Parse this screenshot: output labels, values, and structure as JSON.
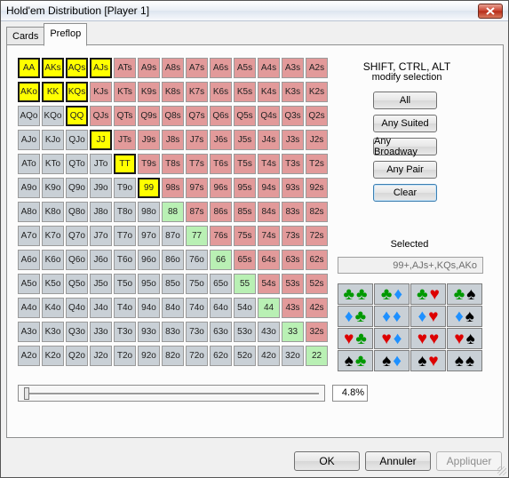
{
  "window": {
    "title": "Hold'em Distribution [Player 1]"
  },
  "tabs": [
    {
      "label": "Cards"
    },
    {
      "label": "Preflop"
    }
  ],
  "grid": {
    "rows": [
      [
        "AA",
        "AKs",
        "AQs",
        "AJs",
        "ATs",
        "A9s",
        "A8s",
        "A7s",
        "A6s",
        "A5s",
        "A4s",
        "A3s",
        "A2s"
      ],
      [
        "AKo",
        "KK",
        "KQs",
        "KJs",
        "KTs",
        "K9s",
        "K8s",
        "K7s",
        "K6s",
        "K5s",
        "K4s",
        "K3s",
        "K2s"
      ],
      [
        "AQo",
        "KQo",
        "QQ",
        "QJs",
        "QTs",
        "Q9s",
        "Q8s",
        "Q7s",
        "Q6s",
        "Q5s",
        "Q4s",
        "Q3s",
        "Q2s"
      ],
      [
        "AJo",
        "KJo",
        "QJo",
        "JJ",
        "JTs",
        "J9s",
        "J8s",
        "J7s",
        "J6s",
        "J5s",
        "J4s",
        "J3s",
        "J2s"
      ],
      [
        "ATo",
        "KTo",
        "QTo",
        "JTo",
        "TT",
        "T9s",
        "T8s",
        "T7s",
        "T6s",
        "T5s",
        "T4s",
        "T3s",
        "T2s"
      ],
      [
        "A9o",
        "K9o",
        "Q9o",
        "J9o",
        "T9o",
        "99",
        "98s",
        "97s",
        "96s",
        "95s",
        "94s",
        "93s",
        "92s"
      ],
      [
        "A8o",
        "K8o",
        "Q8o",
        "J8o",
        "T8o",
        "98o",
        "88",
        "87s",
        "86s",
        "85s",
        "84s",
        "83s",
        "82s"
      ],
      [
        "A7o",
        "K7o",
        "Q7o",
        "J7o",
        "T7o",
        "97o",
        "87o",
        "77",
        "76s",
        "75s",
        "74s",
        "73s",
        "72s"
      ],
      [
        "A6o",
        "K6o",
        "Q6o",
        "J6o",
        "T6o",
        "96o",
        "86o",
        "76o",
        "66",
        "65s",
        "64s",
        "63s",
        "62s"
      ],
      [
        "A5o",
        "K5o",
        "Q5o",
        "J5o",
        "T5o",
        "95o",
        "85o",
        "75o",
        "65o",
        "55",
        "54s",
        "53s",
        "52s"
      ],
      [
        "A4o",
        "K4o",
        "Q4o",
        "J4o",
        "T4o",
        "94o",
        "84o",
        "74o",
        "64o",
        "54o",
        "44",
        "43s",
        "42s"
      ],
      [
        "A3o",
        "K3o",
        "Q3o",
        "J3o",
        "T3o",
        "93o",
        "83o",
        "73o",
        "63o",
        "53o",
        "43o",
        "33",
        "32s"
      ],
      [
        "A2o",
        "K2o",
        "Q2o",
        "J2o",
        "T2o",
        "92o",
        "82o",
        "72o",
        "62o",
        "52o",
        "42o",
        "32o",
        "22"
      ]
    ],
    "selected": [
      "AA",
      "KK",
      "QQ",
      "JJ",
      "TT",
      "99",
      "AKs",
      "AQs",
      "AJs",
      "KQs",
      "AKo"
    ]
  },
  "modify": {
    "line1": "SHIFT, CTRL, ALT",
    "line2": "modify selection"
  },
  "buttons": {
    "all": "All",
    "any_suited": "Any Suited",
    "any_broadway": "Any Broadway",
    "any_pair": "Any Pair",
    "clear": "Clear"
  },
  "selected_panel": {
    "label": "Selected",
    "value": "99+,AJs+,KQs,AKo"
  },
  "suit_combos": [
    [
      [
        "clubs",
        "clubs"
      ],
      [
        "clubs",
        "diamonds"
      ],
      [
        "clubs",
        "hearts"
      ],
      [
        "clubs",
        "spades"
      ]
    ],
    [
      [
        "diamonds",
        "clubs"
      ],
      [
        "diamonds",
        "diamonds"
      ],
      [
        "diamonds",
        "hearts"
      ],
      [
        "diamonds",
        "spades"
      ]
    ],
    [
      [
        "hearts",
        "clubs"
      ],
      [
        "hearts",
        "diamonds"
      ],
      [
        "hearts",
        "hearts"
      ],
      [
        "hearts",
        "spades"
      ]
    ],
    [
      [
        "spades",
        "clubs"
      ],
      [
        "spades",
        "diamonds"
      ],
      [
        "spades",
        "hearts"
      ],
      [
        "spades",
        "spades"
      ]
    ]
  ],
  "range_slider": {
    "percent_text": "4.8%",
    "level": 0.048
  },
  "footer": {
    "ok": "OK",
    "cancel": "Annuler",
    "apply": "Appliquer"
  },
  "colors": {
    "suited": "#e29a9a",
    "offsuit": "#c9d0d6",
    "selected": "#ffff00",
    "pair_unselected": "#b9f0b4"
  }
}
